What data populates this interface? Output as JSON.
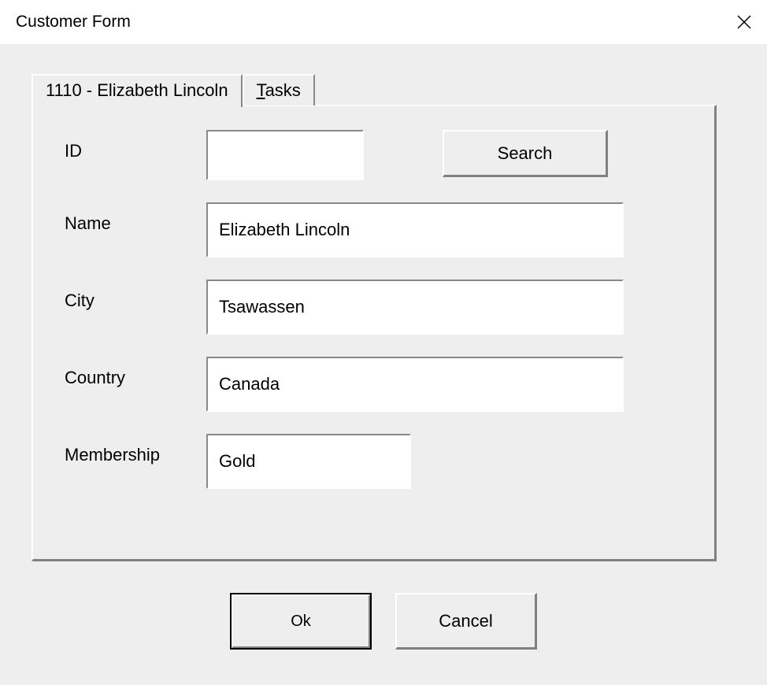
{
  "window": {
    "title": "Customer Form"
  },
  "tabs": [
    {
      "label": "1110 - Elizabeth Lincoln",
      "active": true
    },
    {
      "label": "Tasks",
      "active": false
    }
  ],
  "form": {
    "id": {
      "label": "ID",
      "value": ""
    },
    "name": {
      "label": "Name",
      "value": "Elizabeth Lincoln"
    },
    "city": {
      "label": "City",
      "value": "Tsawassen"
    },
    "country": {
      "label": "Country",
      "value": "Canada"
    },
    "membership": {
      "label": "Membership",
      "value": "Gold"
    }
  },
  "buttons": {
    "search": "Search",
    "ok": "Ok",
    "cancel": "Cancel"
  }
}
